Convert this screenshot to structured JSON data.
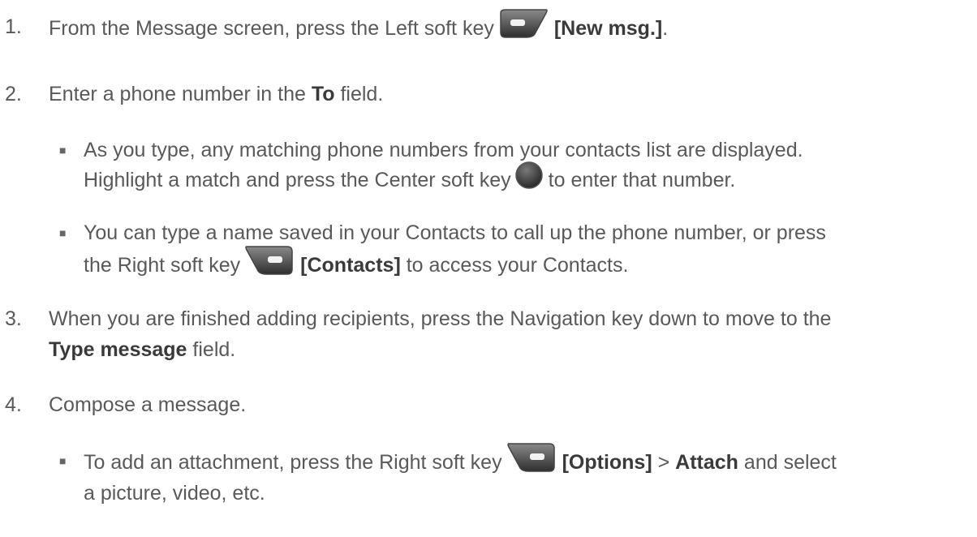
{
  "steps": [
    {
      "num": "1.",
      "pre": "From the Message screen, press the Left soft key",
      "bold": "[New msg.]",
      "post": "."
    },
    {
      "num": "2.",
      "pre": "Enter a phone number in the ",
      "bold": "To",
      "post": " field."
    },
    {
      "num": "3.",
      "line1": "When you are finished adding recipients, press the Navigation key down to move to the",
      "bold": "Type message",
      "post": " field."
    },
    {
      "num": "4.",
      "text": "Compose a message."
    }
  ],
  "bullets": [
    {
      "line1": "As you type, any matching phone numbers from your contacts list are displayed.",
      "line2_pre": "Highlight a match and press the Center soft key",
      "line2_post": "to enter that number."
    },
    {
      "line1": "You can type a name saved in your Contacts to call up the phone number, or press",
      "line2_pre": "the Right soft key",
      "bold": "[Contacts]",
      "line2_post": " to access your Contacts."
    },
    {
      "line1_pre": "To add an attachment, press the Right soft key",
      "bold1": "[Options]",
      "sep": " > ",
      "bold2": "Attach",
      "line1_post": " and select",
      "line2": "a picture, video, etc."
    }
  ],
  "icons": {
    "left_soft_key": "left-soft-key-icon",
    "center_soft_key": "center-soft-key-icon",
    "right_soft_key": "right-soft-key-icon"
  }
}
